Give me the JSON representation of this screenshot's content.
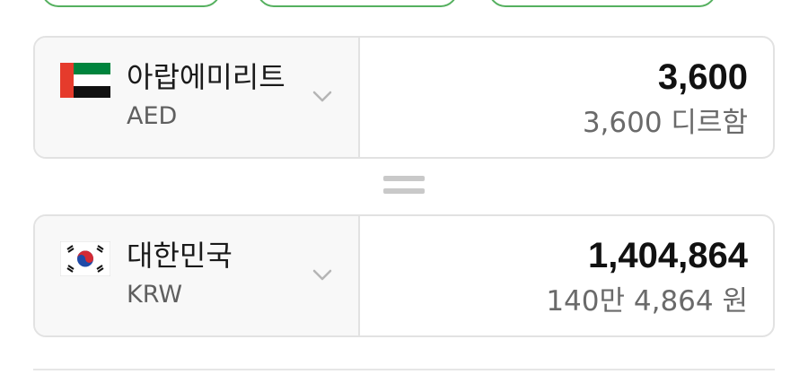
{
  "top_buttons": [
    "",
    "",
    ""
  ],
  "from_currency": {
    "country": "아랍에미리트",
    "code": "AED",
    "amount": "3,600",
    "amount_words": "3,600 디르함",
    "flag_icon": "uae-flag-icon"
  },
  "equals_icon": "equals-icon",
  "to_currency": {
    "country": "대한민국",
    "code": "KRW",
    "amount": "1,404,864",
    "amount_words": "140만 4,864 원",
    "flag_icon": "korea-flag-icon"
  },
  "colors": {
    "accent_green": "#55b05f",
    "border": "#e2e2e2",
    "secondary_text": "#6a6a6a"
  }
}
